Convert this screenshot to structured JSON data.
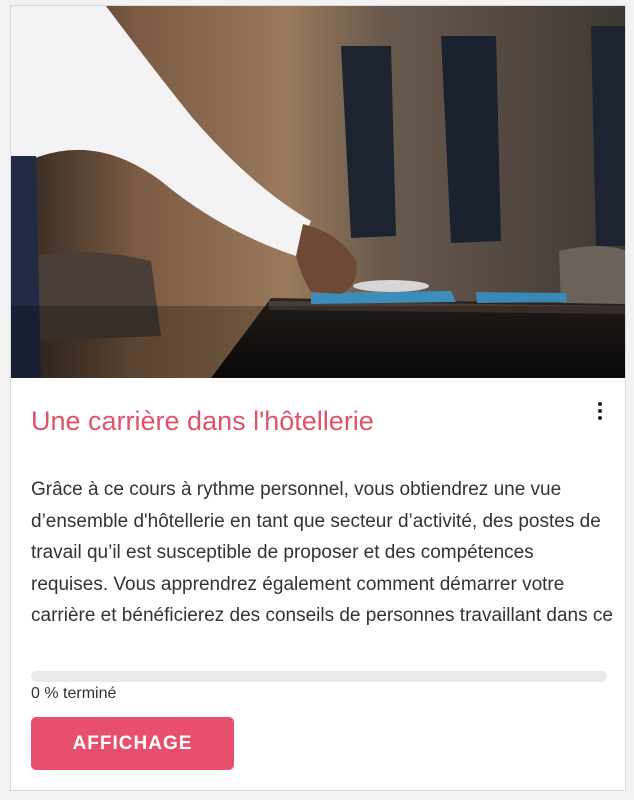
{
  "course": {
    "title": "Une carrière dans l'hôtellerie",
    "description": "Grâce à ce cours à rythme personnel, vous obtiendrez une vue d’ensemble d'hôtellerie en tant que secteur d’activité, des postes de travail qu’il est susceptible de proposer et des compétences requises. Vous apprendrez également comment démarrer votre carrière et bénéficierez des conseils de personnes travaillant dans ce secteur.",
    "progress_percent": 0,
    "progress_label": "0 % terminé",
    "action_label": "AFFICHAGE",
    "menu_icon": "more-vertical-icon",
    "image_subject": "waiter-setting-table-photo"
  },
  "colors": {
    "accent": "#e0516b",
    "button": "#e84f6e",
    "track": "#e8e9eb"
  }
}
